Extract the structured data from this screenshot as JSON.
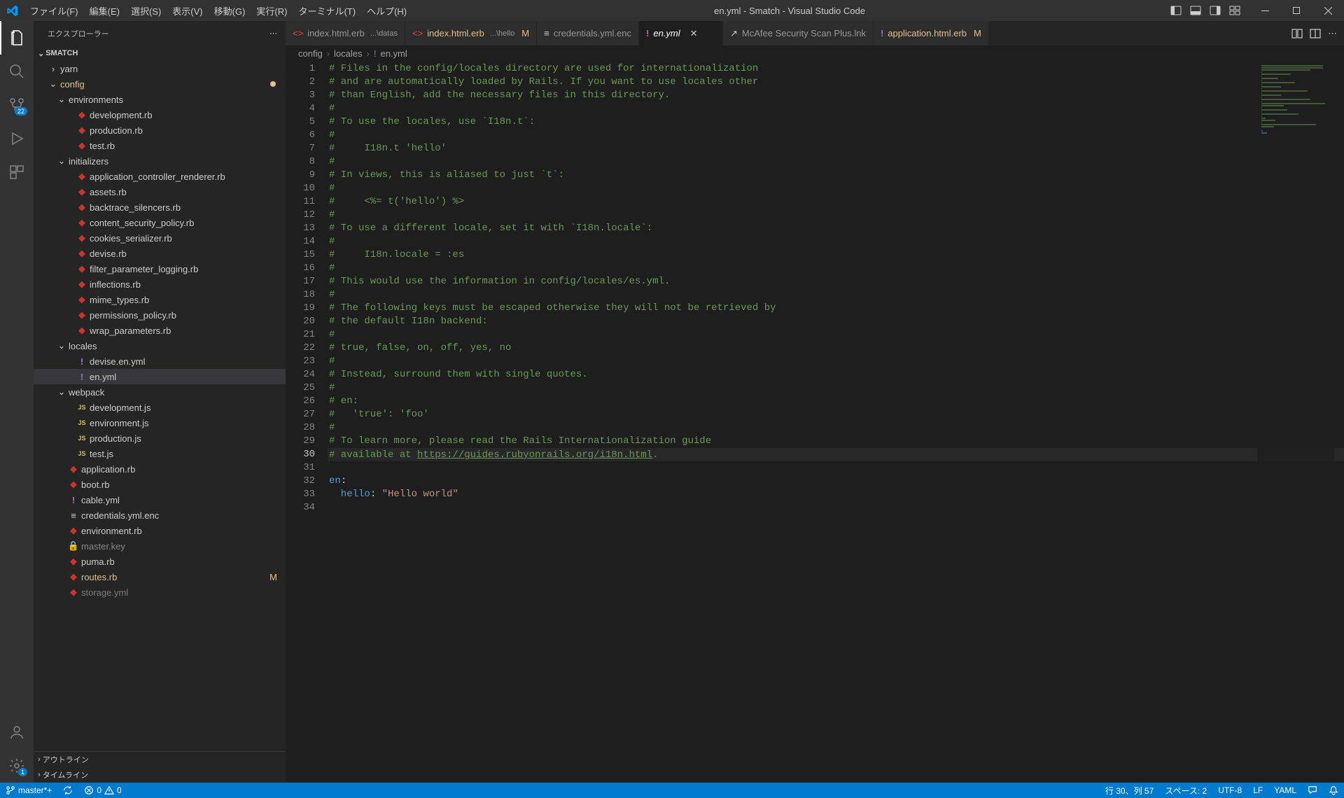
{
  "titlebar": {
    "menu": [
      "ファイル(F)",
      "編集(E)",
      "選択(S)",
      "表示(V)",
      "移動(G)",
      "実行(R)",
      "ターミナル(T)",
      "ヘルプ(H)"
    ],
    "title": "en.yml - Smatch - Visual Studio Code"
  },
  "activitybar": {
    "scm_badge": "22",
    "settings_badge": "1"
  },
  "sidebar": {
    "header": "エクスプローラー",
    "project": "SMATCH",
    "tree": [
      {
        "type": "folder",
        "name": "yarn",
        "depth": 1,
        "icon": "›",
        "open": false
      },
      {
        "type": "folder",
        "name": "config",
        "depth": 1,
        "icon": "⌄",
        "open": true,
        "git": true
      },
      {
        "type": "folder",
        "name": "environments",
        "depth": 2,
        "icon": "⌄",
        "open": true
      },
      {
        "type": "file",
        "name": "development.rb",
        "depth": 3,
        "ficon": "ruby"
      },
      {
        "type": "file",
        "name": "production.rb",
        "depth": 3,
        "ficon": "ruby"
      },
      {
        "type": "file",
        "name": "test.rb",
        "depth": 3,
        "ficon": "ruby"
      },
      {
        "type": "folder",
        "name": "initializers",
        "depth": 2,
        "icon": "⌄",
        "open": true
      },
      {
        "type": "file",
        "name": "application_controller_renderer.rb",
        "depth": 3,
        "ficon": "ruby"
      },
      {
        "type": "file",
        "name": "assets.rb",
        "depth": 3,
        "ficon": "ruby"
      },
      {
        "type": "file",
        "name": "backtrace_silencers.rb",
        "depth": 3,
        "ficon": "ruby"
      },
      {
        "type": "file",
        "name": "content_security_policy.rb",
        "depth": 3,
        "ficon": "ruby"
      },
      {
        "type": "file",
        "name": "cookies_serializer.rb",
        "depth": 3,
        "ficon": "ruby"
      },
      {
        "type": "file",
        "name": "devise.rb",
        "depth": 3,
        "ficon": "ruby"
      },
      {
        "type": "file",
        "name": "filter_parameter_logging.rb",
        "depth": 3,
        "ficon": "ruby"
      },
      {
        "type": "file",
        "name": "inflections.rb",
        "depth": 3,
        "ficon": "ruby"
      },
      {
        "type": "file",
        "name": "mime_types.rb",
        "depth": 3,
        "ficon": "ruby"
      },
      {
        "type": "file",
        "name": "permissions_policy.rb",
        "depth": 3,
        "ficon": "ruby"
      },
      {
        "type": "file",
        "name": "wrap_parameters.rb",
        "depth": 3,
        "ficon": "ruby"
      },
      {
        "type": "folder",
        "name": "locales",
        "depth": 2,
        "icon": "⌄",
        "open": true
      },
      {
        "type": "file",
        "name": "devise.en.yml",
        "depth": 3,
        "ficon": "yaml"
      },
      {
        "type": "file",
        "name": "en.yml",
        "depth": 3,
        "ficon": "yaml",
        "selected": true
      },
      {
        "type": "folder",
        "name": "webpack",
        "depth": 2,
        "icon": "⌄",
        "open": true
      },
      {
        "type": "file",
        "name": "development.js",
        "depth": 3,
        "ficon": "js"
      },
      {
        "type": "file",
        "name": "environment.js",
        "depth": 3,
        "ficon": "js"
      },
      {
        "type": "file",
        "name": "production.js",
        "depth": 3,
        "ficon": "js"
      },
      {
        "type": "file",
        "name": "test.js",
        "depth": 3,
        "ficon": "js"
      },
      {
        "type": "file",
        "name": "application.rb",
        "depth": 2,
        "ficon": "ruby"
      },
      {
        "type": "file",
        "name": "boot.rb",
        "depth": 2,
        "ficon": "ruby"
      },
      {
        "type": "file",
        "name": "cable.yml",
        "depth": 2,
        "ficon": "yaml"
      },
      {
        "type": "file",
        "name": "credentials.yml.enc",
        "depth": 2,
        "ficon": "text"
      },
      {
        "type": "file",
        "name": "environment.rb",
        "depth": 2,
        "ficon": "ruby"
      },
      {
        "type": "file",
        "name": "master.key",
        "depth": 2,
        "ficon": "lock"
      },
      {
        "type": "file",
        "name": "puma.rb",
        "depth": 2,
        "ficon": "ruby"
      },
      {
        "type": "file",
        "name": "routes.rb",
        "depth": 2,
        "ficon": "ruby",
        "status": "M",
        "git": true
      },
      {
        "type": "file",
        "name": "storage.yml",
        "depth": 2,
        "ficon": "ruby",
        "cut": true
      }
    ],
    "outline": "アウトライン",
    "timeline": "タイムライン"
  },
  "tabs": [
    {
      "icon": "erb",
      "label": "index.html.erb",
      "desc": "...\\datas"
    },
    {
      "icon": "erb",
      "label": "index.html.erb",
      "desc": "...\\hello",
      "mod": "M"
    },
    {
      "icon": "text",
      "label": "credentials.yml.enc"
    },
    {
      "icon": "yaml",
      "label": "en.yml",
      "active": true,
      "preview": true
    },
    {
      "icon": "link",
      "label": "McAfee Security Scan Plus.lnk"
    },
    {
      "icon": "yaml",
      "label": "application.html.erb",
      "mod": "M"
    }
  ],
  "breadcrumbs": {
    "seg1": "config",
    "seg2": "locales",
    "seg3": "en.yml"
  },
  "code_lines": [
    {
      "t": "# Files in the config/locales directory are used for internationalization",
      "c": "comment"
    },
    {
      "t": "# and are automatically loaded by Rails. If you want to use locales other",
      "c": "comment"
    },
    {
      "t": "# than English, add the necessary files in this directory.",
      "c": "comment"
    },
    {
      "t": "#",
      "c": "comment"
    },
    {
      "t": "# To use the locales, use `I18n.t`:",
      "c": "comment"
    },
    {
      "t": "#",
      "c": "comment"
    },
    {
      "t": "#     I18n.t 'hello'",
      "c": "comment"
    },
    {
      "t": "#",
      "c": "comment"
    },
    {
      "t": "# In views, this is aliased to just `t`:",
      "c": "comment"
    },
    {
      "t": "#",
      "c": "comment"
    },
    {
      "t": "#     <%= t('hello') %>",
      "c": "comment"
    },
    {
      "t": "#",
      "c": "comment"
    },
    {
      "t": "# To use a different locale, set it with `I18n.locale`:",
      "c": "comment"
    },
    {
      "t": "#",
      "c": "comment"
    },
    {
      "t": "#     I18n.locale = :es",
      "c": "comment"
    },
    {
      "t": "#",
      "c": "comment"
    },
    {
      "t": "# This would use the information in config/locales/es.yml.",
      "c": "comment"
    },
    {
      "t": "#",
      "c": "comment"
    },
    {
      "t": "# The following keys must be escaped otherwise they will not be retrieved by",
      "c": "comment"
    },
    {
      "t": "# the default I18n backend:",
      "c": "comment"
    },
    {
      "t": "#",
      "c": "comment"
    },
    {
      "t": "# true, false, on, off, yes, no",
      "c": "comment"
    },
    {
      "t": "#",
      "c": "comment"
    },
    {
      "t": "# Instead, surround them with single quotes.",
      "c": "comment"
    },
    {
      "t": "#",
      "c": "comment"
    },
    {
      "t": "# en:",
      "c": "comment"
    },
    {
      "t": "#   'true': 'foo'",
      "c": "comment"
    },
    {
      "t": "#",
      "c": "comment"
    },
    {
      "t": "# To learn more, please read the Rails Internationalization guide",
      "c": "comment"
    },
    {
      "t": "# available at ",
      "c": "comment",
      "link": "https://guides.rubyonrails.org/i18n.html",
      "after": "."
    },
    {
      "t": "",
      "c": "blank"
    },
    {
      "t": "en",
      "c": "key",
      "punct": ":"
    },
    {
      "t": "  hello",
      "c": "key",
      "punct": ": ",
      "str": "\"Hello world\""
    },
    {
      "t": "",
      "c": "blank"
    }
  ],
  "current_line": 30,
  "statusbar": {
    "branch": "master*+",
    "sync": "",
    "errors": "0",
    "warnings": "0",
    "position": "行 30、列 57",
    "spaces": "スペース: 2",
    "encoding": "UTF-8",
    "eol": "LF",
    "lang": "YAML"
  }
}
